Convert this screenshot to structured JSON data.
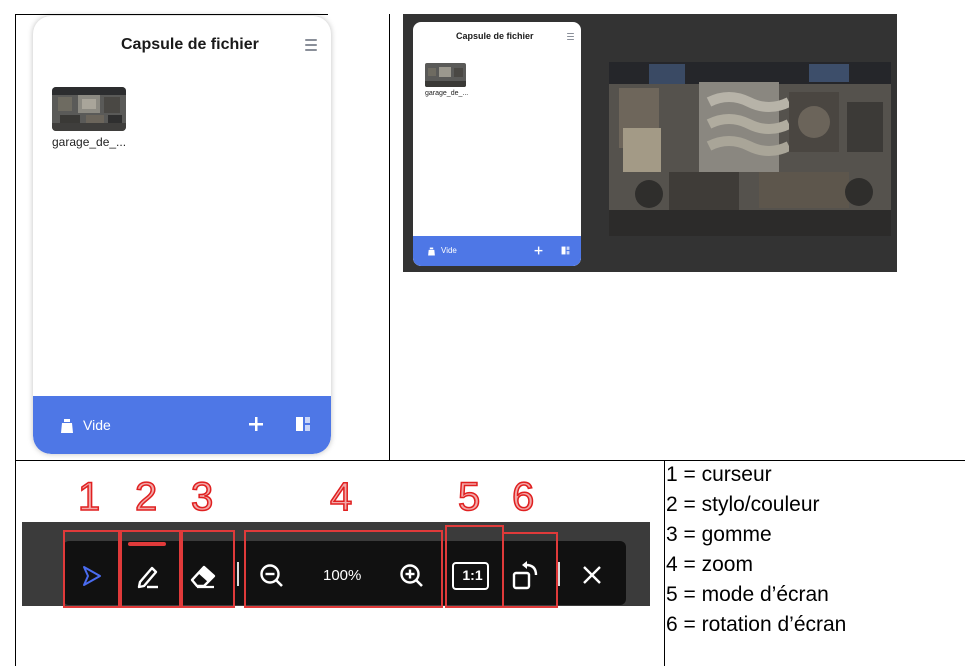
{
  "panel": {
    "title": "Capsule de fichier",
    "file_label": "garage_de_...",
    "footer_label": "Vide"
  },
  "toolbar": {
    "zoom_value": "100%",
    "ratio_label": "1:1",
    "numbers": [
      "1",
      "2",
      "3",
      "4",
      "5",
      "6"
    ]
  },
  "legend": [
    "1 = curseur",
    "2 = stylo/couleur",
    "3 = gomme",
    "4 = zoom",
    "5 = mode d’écran",
    "6 = rotation d’écran"
  ],
  "colors": {
    "footer_blue": "#4e77e6",
    "annotation_red": "#e02a2a",
    "cursor_blue": "#4a6cf0",
    "dark_bg": "#333333"
  }
}
